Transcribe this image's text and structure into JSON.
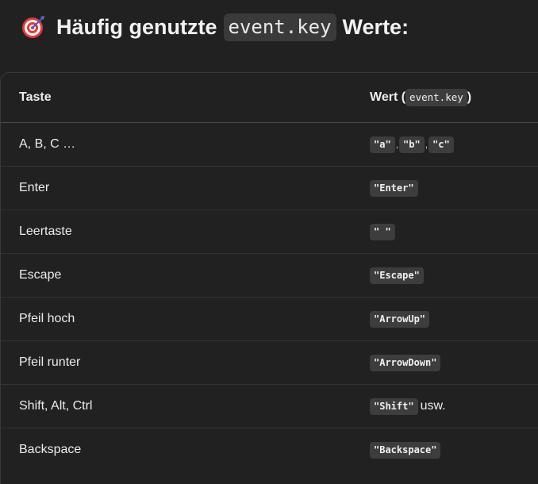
{
  "heading": {
    "icon": "dart-target-icon",
    "prefix": "Häufig genutzte",
    "code": "event.key",
    "suffix": "Werte:"
  },
  "table": {
    "headers": {
      "key": "Taste",
      "value_prefix": "Wert (",
      "value_code": "event.key",
      "value_suffix": ")"
    },
    "rows": [
      {
        "key": "A, B, C …",
        "codes": [
          "\"a\"",
          "\"b\"",
          "\"c\""
        ],
        "separator": ",",
        "after": ""
      },
      {
        "key": "Enter",
        "codes": [
          "\"Enter\""
        ],
        "after": ""
      },
      {
        "key": "Leertaste",
        "codes": [
          "\" \""
        ],
        "after": ""
      },
      {
        "key": "Escape",
        "codes": [
          "\"Escape\""
        ],
        "after": ""
      },
      {
        "key": "Pfeil hoch",
        "codes": [
          "\"ArrowUp\""
        ],
        "after": ""
      },
      {
        "key": "Pfeil runter",
        "codes": [
          "\"ArrowDown\""
        ],
        "after": ""
      },
      {
        "key": "Shift, Alt, Ctrl",
        "codes": [
          "\"Shift\""
        ],
        "after": "usw."
      },
      {
        "key": "Backspace",
        "codes": [
          "\"Backspace\""
        ],
        "after": ""
      }
    ]
  },
  "colors": {
    "background": "#212121",
    "code_background": "#3d3d3d",
    "text": "#ececec"
  }
}
